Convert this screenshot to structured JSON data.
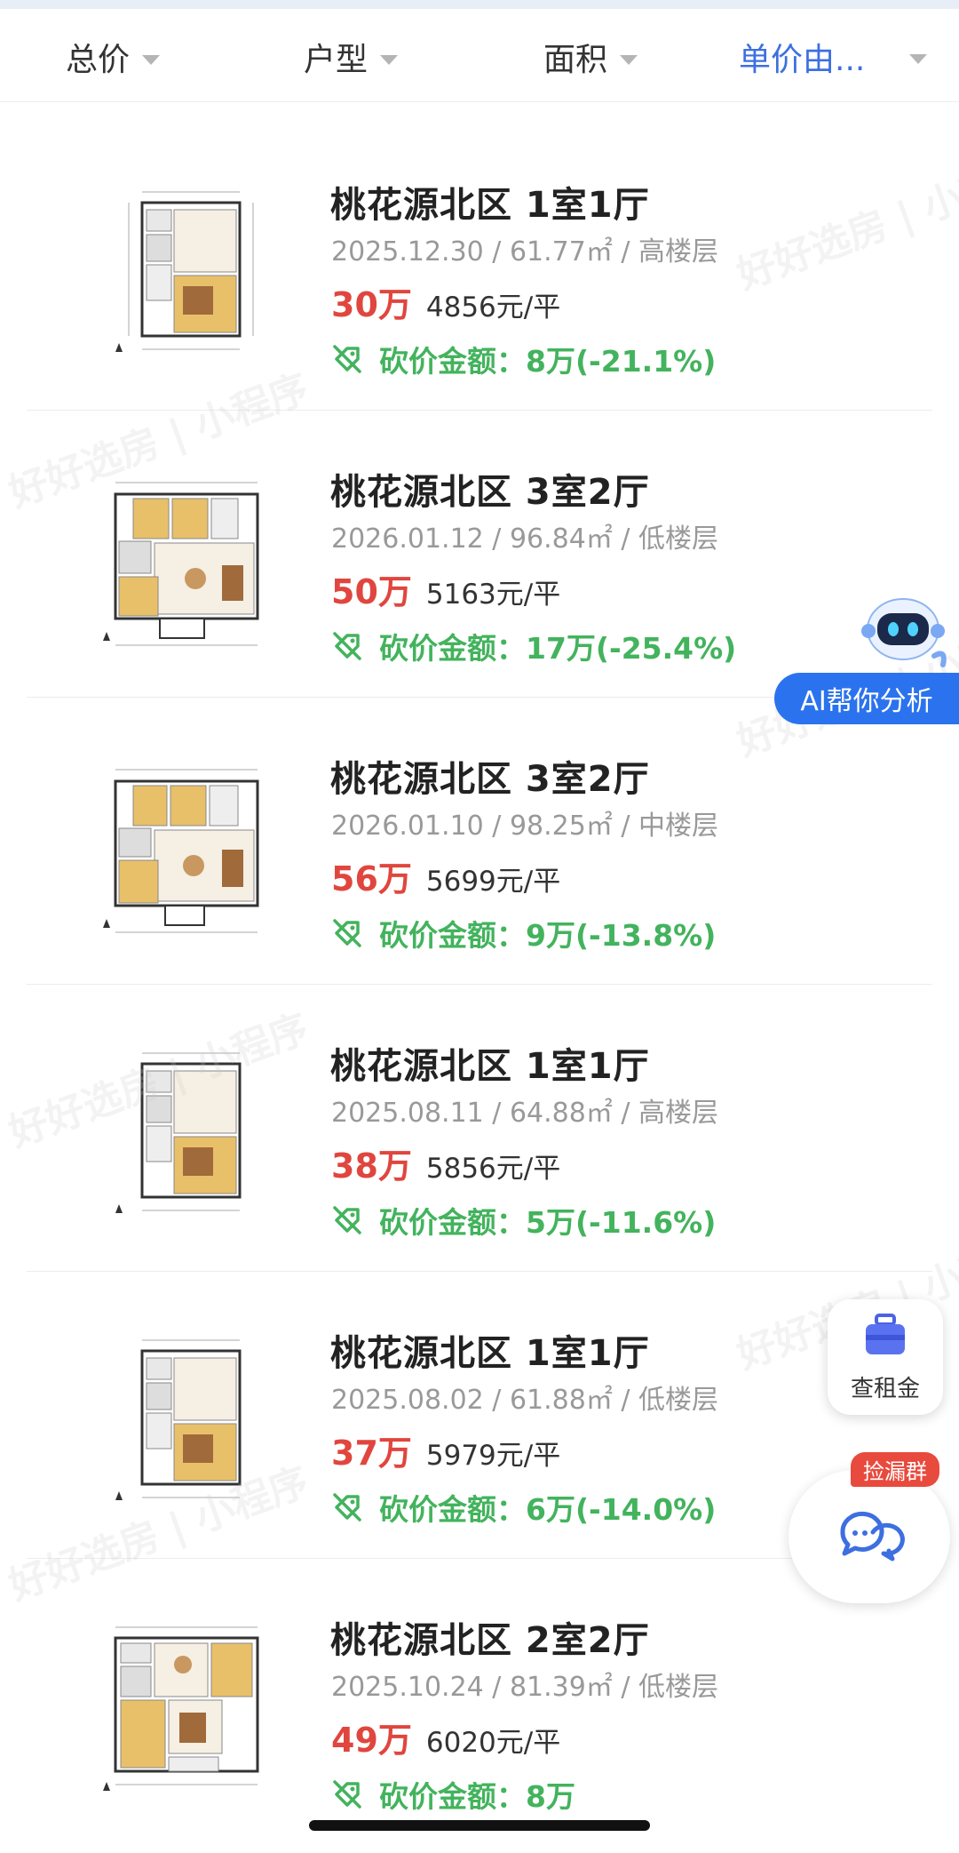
{
  "filters": [
    {
      "label": "总价"
    },
    {
      "label": "户型"
    },
    {
      "label": "面积"
    },
    {
      "label": "单价由..."
    }
  ],
  "colors": {
    "accent": "#3d6fe0",
    "price": "#e0463e",
    "cut": "#43b35d",
    "ai_button": "#2b73ee",
    "badge": "#e84a3d"
  },
  "listings": [
    {
      "title": "桃花源北区 1室1厅",
      "meta": "2025.12.30 / 61.77㎡ / 高楼层",
      "price": "30万",
      "unit_price": "4856元/平",
      "cut": "砍价金额：8万(-21.1%)"
    },
    {
      "title": "桃花源北区 3室2厅",
      "meta": "2026.01.12 / 96.84㎡ / 低楼层",
      "price": "50万",
      "unit_price": "5163元/平",
      "cut": "砍价金额：17万(-25.4%)"
    },
    {
      "title": "桃花源北区 3室2厅",
      "meta": "2026.01.10 / 98.25㎡ / 中楼层",
      "price": "56万",
      "unit_price": "5699元/平",
      "cut": "砍价金额：9万(-13.8%)"
    },
    {
      "title": "桃花源北区 1室1厅",
      "meta": "2025.08.11 / 64.88㎡ / 高楼层",
      "price": "38万",
      "unit_price": "5856元/平",
      "cut": "砍价金额：5万(-11.6%)"
    },
    {
      "title": "桃花源北区 1室1厅",
      "meta": "2025.08.02 / 61.88㎡ / 低楼层",
      "price": "37万",
      "unit_price": "5979元/平",
      "cut": "砍价金额：6万(-14.0%)"
    },
    {
      "title": "桃花源北区 2室2厅",
      "meta": "2025.10.24 / 81.39㎡ / 低楼层",
      "price": "49万",
      "unit_price": "6020元/平",
      "cut": "砍价金额：8万"
    }
  ],
  "floating": {
    "ai_label": "AI帮你分析",
    "rent_label": "查租金",
    "chat_badge": "捡漏群"
  },
  "watermark": {
    "text": "好好选房 | 小程序"
  },
  "icons": {
    "filter_arrow": "triangle-down-icon",
    "cut": "price-tag-cut-icon",
    "rent": "suitcase-icon",
    "chat": "chat-bubbles-icon",
    "ai": "robot-icon"
  }
}
